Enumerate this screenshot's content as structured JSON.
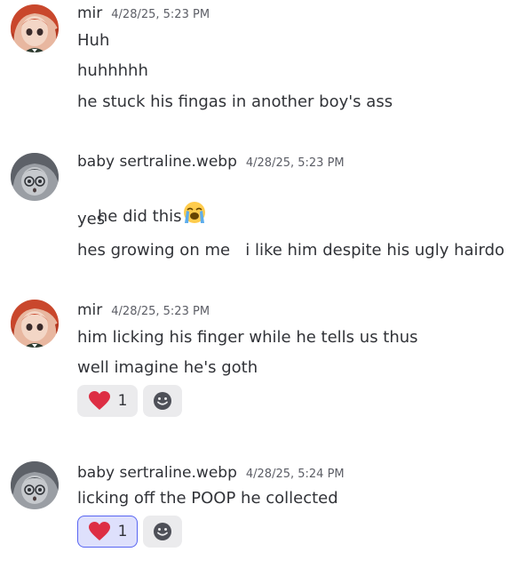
{
  "messages": [
    {
      "author": "mir",
      "timestamp": "4/28/25, 5:23 PM",
      "lines": [
        "Huh",
        "huhhhhh",
        "he stuck his fingas in another boy's ass"
      ]
    },
    {
      "author": "baby sertraline.webp",
      "timestamp": "4/28/25, 5:23 PM",
      "lines": [
        "he did this",
        "yes",
        "hes growing on me   i like him despite his ugly hairdo"
      ]
    },
    {
      "author": "mir",
      "timestamp": "4/28/25, 5:23 PM",
      "lines": [
        "him licking his finger while he tells us thus",
        "well imagine he's goth"
      ],
      "reaction": {
        "emoji": "heart-icon",
        "count": "1",
        "reacted_by_me": false
      }
    },
    {
      "author": "baby sertraline.webp",
      "timestamp": "4/28/25, 5:24 PM",
      "lines": [
        "licking off the POOP he collected"
      ],
      "reaction": {
        "emoji": "heart-icon",
        "count": "1",
        "reacted_by_me": true
      }
    }
  ],
  "icons": {
    "loudly_crying": "loudly-crying-emoji-icon",
    "add_reaction": "add-reaction-icon"
  },
  "colors": {
    "accent": "#5865f2",
    "heart": "#dd2e44"
  }
}
